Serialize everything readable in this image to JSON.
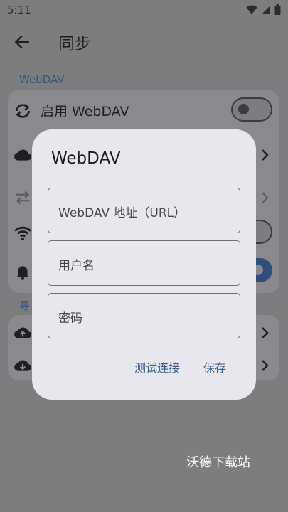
{
  "status_bar": {
    "time": "5:11",
    "icons": [
      "wifi-icon",
      "signal-icon",
      "battery-icon"
    ]
  },
  "app_bar": {
    "title": "同步",
    "back_icon": "arrow-back-icon"
  },
  "sections": [
    {
      "label": "WebDAV"
    },
    {
      "label": "导"
    }
  ],
  "settings": {
    "enable_webdav": {
      "label": "启用 WebDAV",
      "icon": "sync-icon",
      "enabled": false
    },
    "cloud_row": {
      "icon": "cloud-icon"
    },
    "transfer_row": {
      "icon": "swap-icon"
    },
    "wifi_row": {
      "icon": "wifi-icon"
    },
    "notify_row": {
      "icon": "bell-icon"
    },
    "upload_row": {
      "icon": "cloud-upload-icon"
    },
    "download_row": {
      "icon": "cloud-download-icon"
    }
  },
  "dialog": {
    "title": "WebDAV",
    "fields": [
      {
        "placeholder": "WebDAV 地址（URL）"
      },
      {
        "placeholder": "用户名"
      },
      {
        "placeholder": "密码"
      }
    ],
    "actions": {
      "test": "测试连接",
      "save": "保存"
    }
  },
  "watermark": "沃德下载站",
  "colors": {
    "scrim": "#7d7d7f",
    "dialog_bg": "#e7e7ed",
    "accent": "#3d5f8f"
  }
}
